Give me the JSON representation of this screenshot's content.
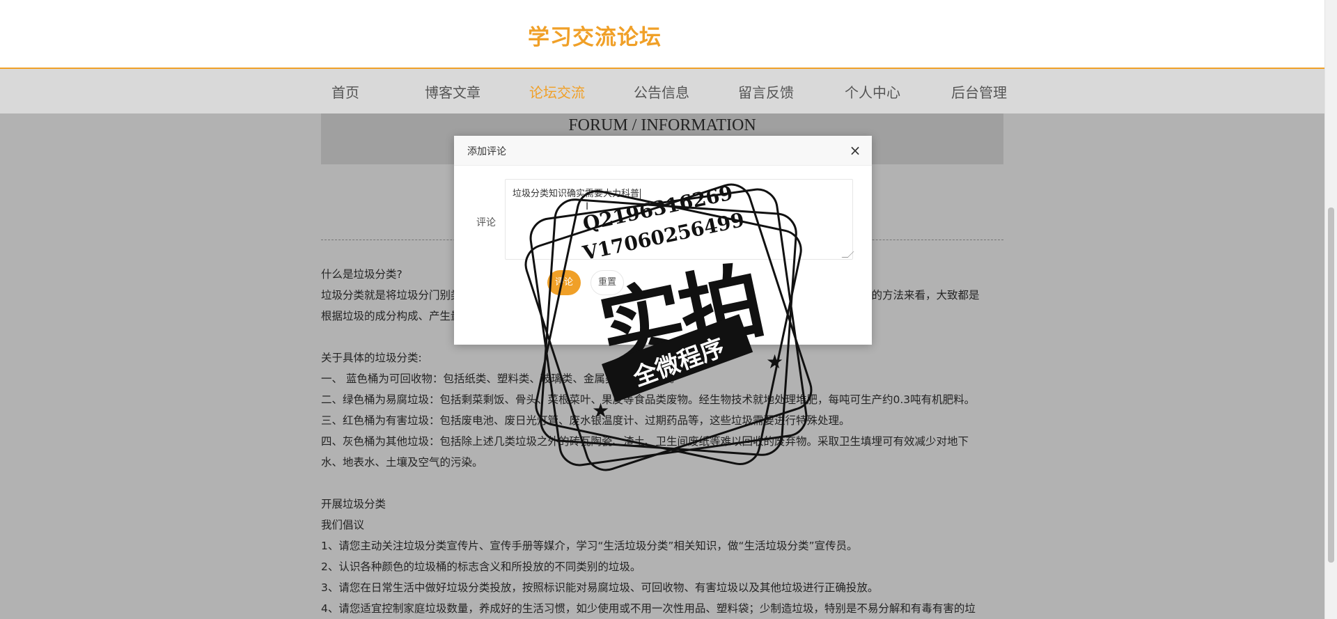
{
  "site": {
    "title": "学习交流论坛"
  },
  "nav": {
    "items": [
      {
        "label": "首页",
        "active": false
      },
      {
        "label": "博客文章",
        "active": false
      },
      {
        "label": "论坛交流",
        "active": true
      },
      {
        "label": "公告信息",
        "active": false
      },
      {
        "label": "留言反馈",
        "active": false
      },
      {
        "label": "个人中心",
        "active": false
      },
      {
        "label": "后台管理",
        "active": false
      }
    ]
  },
  "banner": {
    "text": "FORUM / INFORMATION"
  },
  "article": {
    "lines": [
      "什么是垃圾分类?",
      "垃圾分类就是将垃圾分门别类地投放，并通过分类地清运和回收使之重新变成资源。从国内外各城市对生活垃圾分类的方法来看，大致都是",
      "根据垃圾的成分构成、产生量，结合本地垃圾的资源利用和处理方式来进行分类。",
      "",
      "关于具体的垃圾分类:",
      "一、 蓝色桶为可回收物：包括纸类、塑料类、玻璃类、金属类和纺织类等。",
      "二、绿色桶为易腐垃圾：包括剩菜剩饭、骨头、菜根菜叶、果皮等食品类废物。经生物技术就地处理堆肥，每吨可生产约0.3吨有机肥料。",
      "三、红色桶为有害垃圾：包括废电池、废日光灯管、废水银温度计、过期药品等，这些垃圾需要进行特殊处理。",
      "四、灰色桶为其他垃圾：包括除上述几类垃圾之外的砖瓦陶瓷、渣土、卫生间废纸等难以回收的废弃物。采取卫生填埋可有效减少对地下",
      "水、地表水、土壤及空气的污染。",
      "",
      "开展垃圾分类",
      "我们倡议",
      "1、请您主动关注垃圾分类宣传片、宣传手册等媒介，学习“生活垃圾分类”相关知识，做“生活垃圾分类”宣传员。",
      "2、认识各种颜色的垃圾桶的标志含义和所投放的不同类别的垃圾。",
      "3、请您在日常生活中做好垃圾分类投放，按照标识能对易腐垃圾、可回收物、有害垃圾以及其他垃圾进行正确投放。",
      "4、请您适宜控制家庭垃圾数量，养成好的生活习惯，如少使用或不用一次性用品、塑料袋；少制造垃圾，特别是不易分解和有毒有害的垃"
    ]
  },
  "dialog": {
    "title": "添加评论",
    "close_symbol": "×",
    "comment_label": "评论",
    "comment_value": "垃圾分类知识确实需要大力科普",
    "submit_label": "评论",
    "reset_label": "重置"
  },
  "watermark": {
    "qq": "Q2196316269",
    "vx": "V17060256499",
    "big": "实拍",
    "ribbon": "全微程序"
  }
}
